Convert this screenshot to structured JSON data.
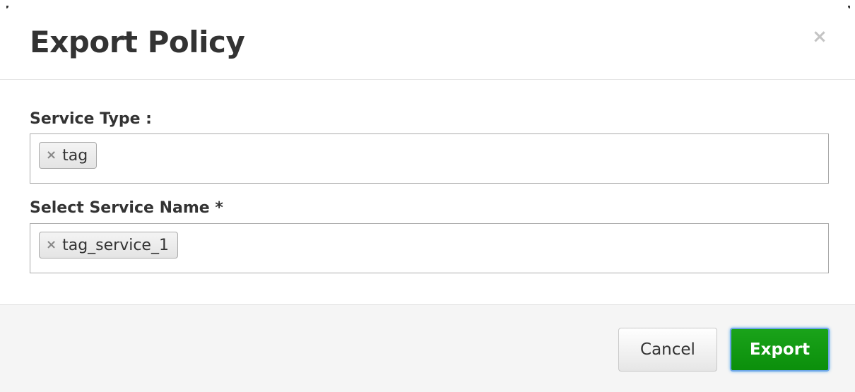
{
  "dialog": {
    "title": "Export Policy",
    "close_symbol": "×"
  },
  "form": {
    "service_type": {
      "label": "Service Type :",
      "selected": [
        {
          "remove_symbol": "×",
          "value": "tag"
        }
      ]
    },
    "service_name": {
      "label": "Select Service Name *",
      "selected": [
        {
          "remove_symbol": "×",
          "value": "tag_service_1"
        }
      ]
    }
  },
  "footer": {
    "cancel_label": "Cancel",
    "export_label": "Export"
  },
  "colors": {
    "export_button": "#0b9a0b",
    "focus_ring": "#6ea6e8"
  },
  "icons": {
    "close": "close-icon",
    "chip_remove": "remove-icon"
  }
}
